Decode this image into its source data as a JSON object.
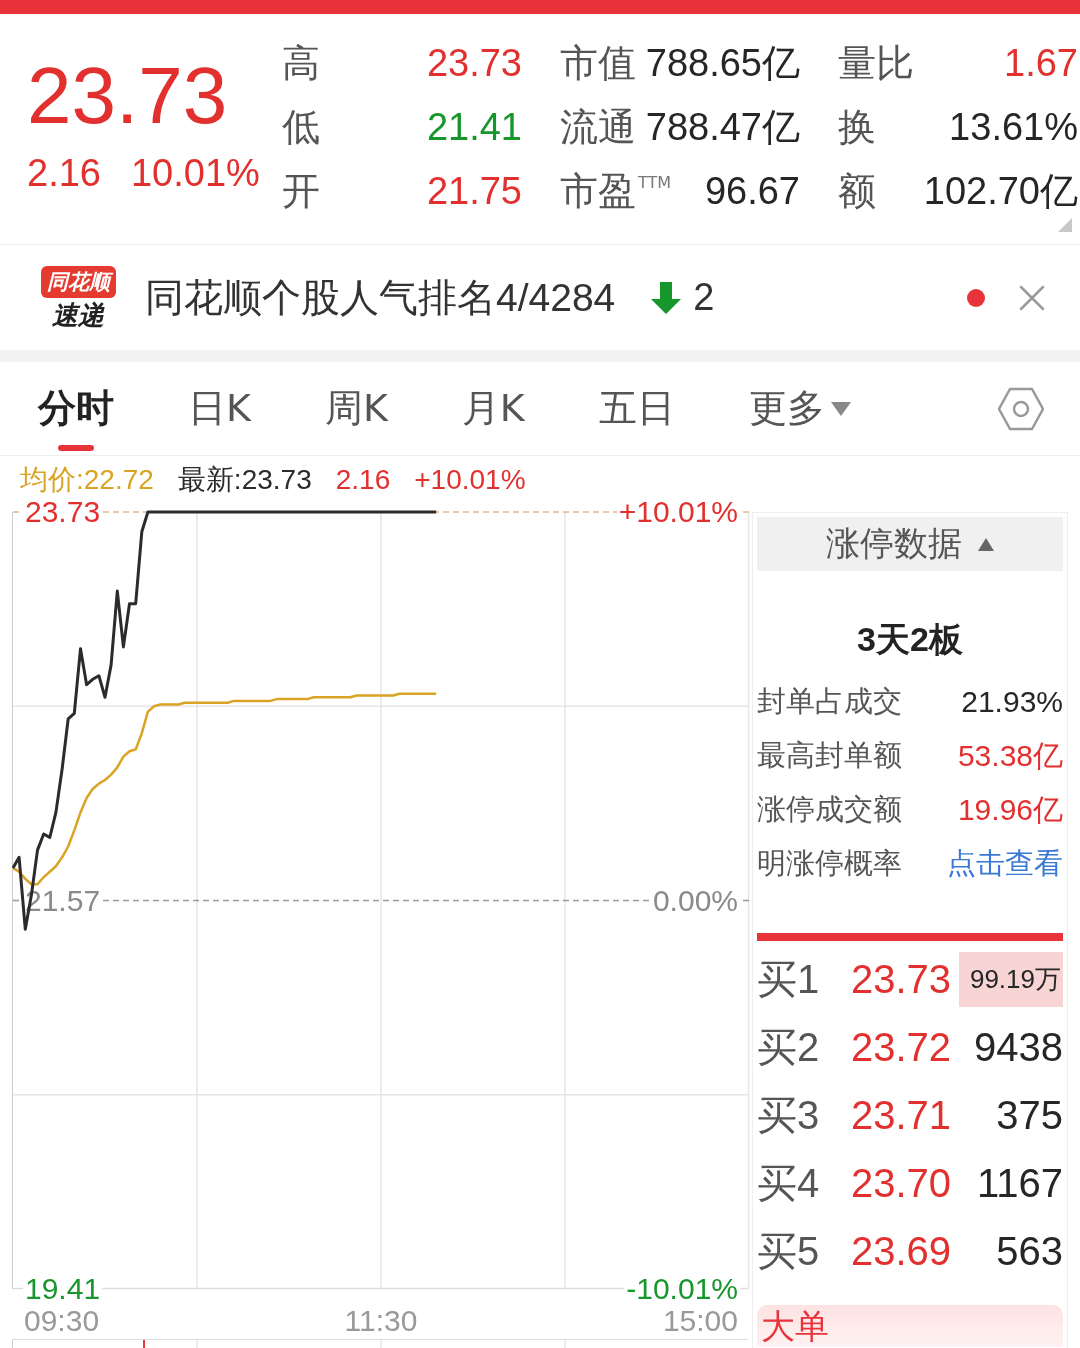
{
  "quote": {
    "price": "23.73",
    "change": "2.16",
    "change_percent": "10.01%",
    "color": "#e2302f"
  },
  "stats": [
    {
      "label": "高",
      "value": "23.73",
      "color": "#e2302f"
    },
    {
      "label": "市值",
      "value": "788.65亿",
      "color": "#262626"
    },
    {
      "label": "量比",
      "value": "1.67",
      "color": "#e2302f"
    },
    {
      "label": "低",
      "value": "21.41",
      "color": "#17962b"
    },
    {
      "label": "流通",
      "value": "788.47亿",
      "color": "#262626"
    },
    {
      "label": "换",
      "value": "13.61%",
      "color": "#262626"
    },
    {
      "label": "开",
      "value": "21.75",
      "color": "#e2302f"
    },
    {
      "label": "市盈$^{TTM}$",
      "value": "96.67",
      "color": "#262626"
    },
    {
      "label": "额",
      "value": "102.70亿",
      "color": "#262626"
    }
  ],
  "news_banner": {
    "logo_top": "同花顺",
    "logo_bottom": "速递",
    "text": "同花顺个股人气排名4/4284",
    "rank_down": true,
    "rank_change": "2",
    "unread": true
  },
  "tabs": [
    {
      "label": "分时",
      "selected": true,
      "kind": "plain"
    },
    {
      "label": "日K",
      "selected": false,
      "kind": "plain"
    },
    {
      "label": "周K",
      "selected": false,
      "kind": "plain"
    },
    {
      "label": "月K",
      "selected": false,
      "kind": "plain"
    },
    {
      "label": "五日",
      "selected": false,
      "kind": "plain"
    },
    {
      "label": "更多",
      "selected": false,
      "kind": "menu"
    }
  ],
  "chart": {
    "legend": [
      {
        "text": "均价:22.72",
        "color": "#d9a324"
      },
      {
        "text": "最新:23.73",
        "color": "#2b2b2b"
      },
      {
        "text": "2.16",
        "color": "#e2302f"
      },
      {
        "text": "+10.01%",
        "color": "#e2302f"
      }
    ],
    "right_labels": [
      "+10.01%",
      "0.00%",
      "-10.01%"
    ],
    "time_labels": [
      "09:30",
      "11:30",
      "15:00"
    ],
    "chart_data": {
      "type": "line",
      "grid": true,
      "categories": [
        null,
        null,
        null,
        null,
        null,
        null,
        null,
        null,
        null,
        null,
        null,
        null,
        null,
        null,
        null,
        null,
        null,
        null,
        null,
        null,
        null,
        null,
        null,
        null,
        null,
        null,
        null,
        null,
        null,
        null,
        null,
        null,
        null,
        null,
        null,
        null,
        null,
        null,
        null,
        null,
        null,
        null,
        null,
        null,
        null,
        null,
        null,
        null,
        null,
        null,
        null,
        null,
        null,
        null,
        null,
        null,
        null,
        null,
        null,
        null,
        null,
        null,
        null,
        null,
        null,
        null,
        null,
        null,
        null,
        null,
        null,
        null,
        null,
        null,
        null,
        null,
        null,
        null,
        null,
        null,
        null,
        null,
        null,
        null,
        null,
        null,
        null,
        null,
        null,
        null,
        null,
        null,
        null,
        null,
        null,
        null,
        null,
        null,
        null,
        null,
        null,
        null,
        null,
        null,
        null,
        null,
        null,
        null,
        null,
        null,
        null,
        null,
        null,
        null,
        null,
        null,
        null,
        null,
        null,
        null,
        null
      ],
      "series": [
        {
          "color": "#2b2b2b",
          "values": [
            21.75,
            21.81,
            21.41,
            21.6,
            21.85,
            21.94,
            21.92,
            22.06,
            22.3,
            22.58,
            22.61,
            22.97,
            22.77,
            22.8,
            22.82,
            22.7,
            22.88,
            23.29,
            22.98,
            23.22,
            23.22,
            23.62,
            23.73,
            23.73,
            23.73,
            23.73,
            23.73,
            23.73,
            23.73,
            23.73,
            23.73,
            23.73,
            23.73,
            23.73,
            23.73,
            23.73,
            23.73,
            23.73,
            23.73,
            23.73,
            23.73,
            23.73,
            23.73,
            23.73,
            23.73,
            23.73,
            23.73,
            23.73,
            23.73,
            23.73,
            23.73,
            23.73,
            23.73,
            23.73,
            23.73,
            23.73,
            23.73,
            23.73,
            23.73,
            23.73,
            23.73,
            23.73,
            23.73,
            23.73,
            23.73,
            23.73,
            23.73,
            23.73,
            23.73,
            23.73,
            null,
            null,
            null,
            null,
            null,
            null,
            null,
            null,
            null,
            null,
            null,
            null,
            null,
            null,
            null,
            null,
            null,
            null,
            null,
            null,
            null,
            null,
            null,
            null,
            null,
            null,
            null,
            null,
            null,
            null,
            null,
            null,
            null,
            null,
            null,
            null,
            null,
            null,
            null,
            null,
            null,
            null,
            null,
            null,
            null,
            null,
            null,
            null,
            null,
            null,
            null
          ]
        },
        {
          "color": "#d9a324",
          "values": [
            21.75,
            21.73,
            21.69,
            21.66,
            21.66,
            21.7,
            21.73,
            21.76,
            21.81,
            21.87,
            21.96,
            22.06,
            22.14,
            22.19,
            22.22,
            22.24,
            22.27,
            22.31,
            22.37,
            22.4,
            22.41,
            22.5,
            22.62,
            22.65,
            22.66,
            22.66,
            22.66,
            22.66,
            22.67,
            22.67,
            22.67,
            22.67,
            22.67,
            22.67,
            22.67,
            22.67,
            22.68,
            22.68,
            22.68,
            22.68,
            22.68,
            22.68,
            22.68,
            22.69,
            22.69,
            22.69,
            22.69,
            22.69,
            22.69,
            22.7,
            22.7,
            22.7,
            22.7,
            22.7,
            22.7,
            22.7,
            22.71,
            22.71,
            22.71,
            22.71,
            22.71,
            22.71,
            22.71,
            22.72,
            22.72,
            22.72,
            22.72,
            22.72,
            22.72,
            22.72,
            null,
            null,
            null,
            null,
            null,
            null,
            null,
            null,
            null,
            null,
            null,
            null,
            null,
            null,
            null,
            null,
            null,
            null,
            null,
            null,
            null,
            null,
            null,
            null,
            null,
            null,
            null,
            null,
            null,
            null,
            null,
            null,
            null,
            null,
            null,
            null,
            null,
            null,
            null,
            null,
            null,
            null,
            null,
            null,
            null,
            null,
            null,
            null,
            null,
            null,
            null
          ]
        }
      ],
      "ylim": [
        19.41,
        23.73
      ],
      "yticks": [
        {
          "value": 23.73,
          "label": "23.73"
        },
        {
          "value": 21.57,
          "label": "21.57"
        },
        {
          "value": 19.41,
          "label": "19.41"
        }
      ],
      "ref_lines": [
        {
          "axis": "y",
          "value": 23.73,
          "color": "#e2b88f"
        },
        {
          "axis": "y",
          "value": 21.57,
          "color": "#9a9a9a"
        }
      ]
    }
  },
  "limit_up_panel": {
    "title": "涨停数据",
    "expanded": true,
    "summary": "3天2板",
    "rows": [
      {
        "label": "封单占成交",
        "value": "21.93%",
        "kind": "value",
        "color": "#262626"
      },
      {
        "label": "最高封单额",
        "value": "53.38亿",
        "kind": "value",
        "color": "#e2302f"
      },
      {
        "label": "涨停成交额",
        "value": "19.96亿",
        "kind": "value",
        "color": "#e2302f"
      },
      {
        "label": "明涨停概率",
        "value": "点击查看",
        "kind": "link"
      }
    ]
  },
  "order_book": {
    "bids": [
      {
        "label": "买1",
        "price": "23.73",
        "color": "#e2302f",
        "volume": "99.19万",
        "highlighted": true
      },
      {
        "label": "买2",
        "price": "23.72",
        "color": "#e2302f",
        "volume": "9438",
        "highlighted": false
      },
      {
        "label": "买3",
        "price": "23.71",
        "color": "#e2302f",
        "volume": "375",
        "highlighted": false
      },
      {
        "label": "买4",
        "price": "23.70",
        "color": "#e2302f",
        "volume": "1167",
        "highlighted": false
      },
      {
        "label": "买5",
        "price": "23.69",
        "color": "#e2302f",
        "volume": "563",
        "highlighted": false
      }
    ]
  },
  "big_orders": {
    "title": "大单"
  }
}
